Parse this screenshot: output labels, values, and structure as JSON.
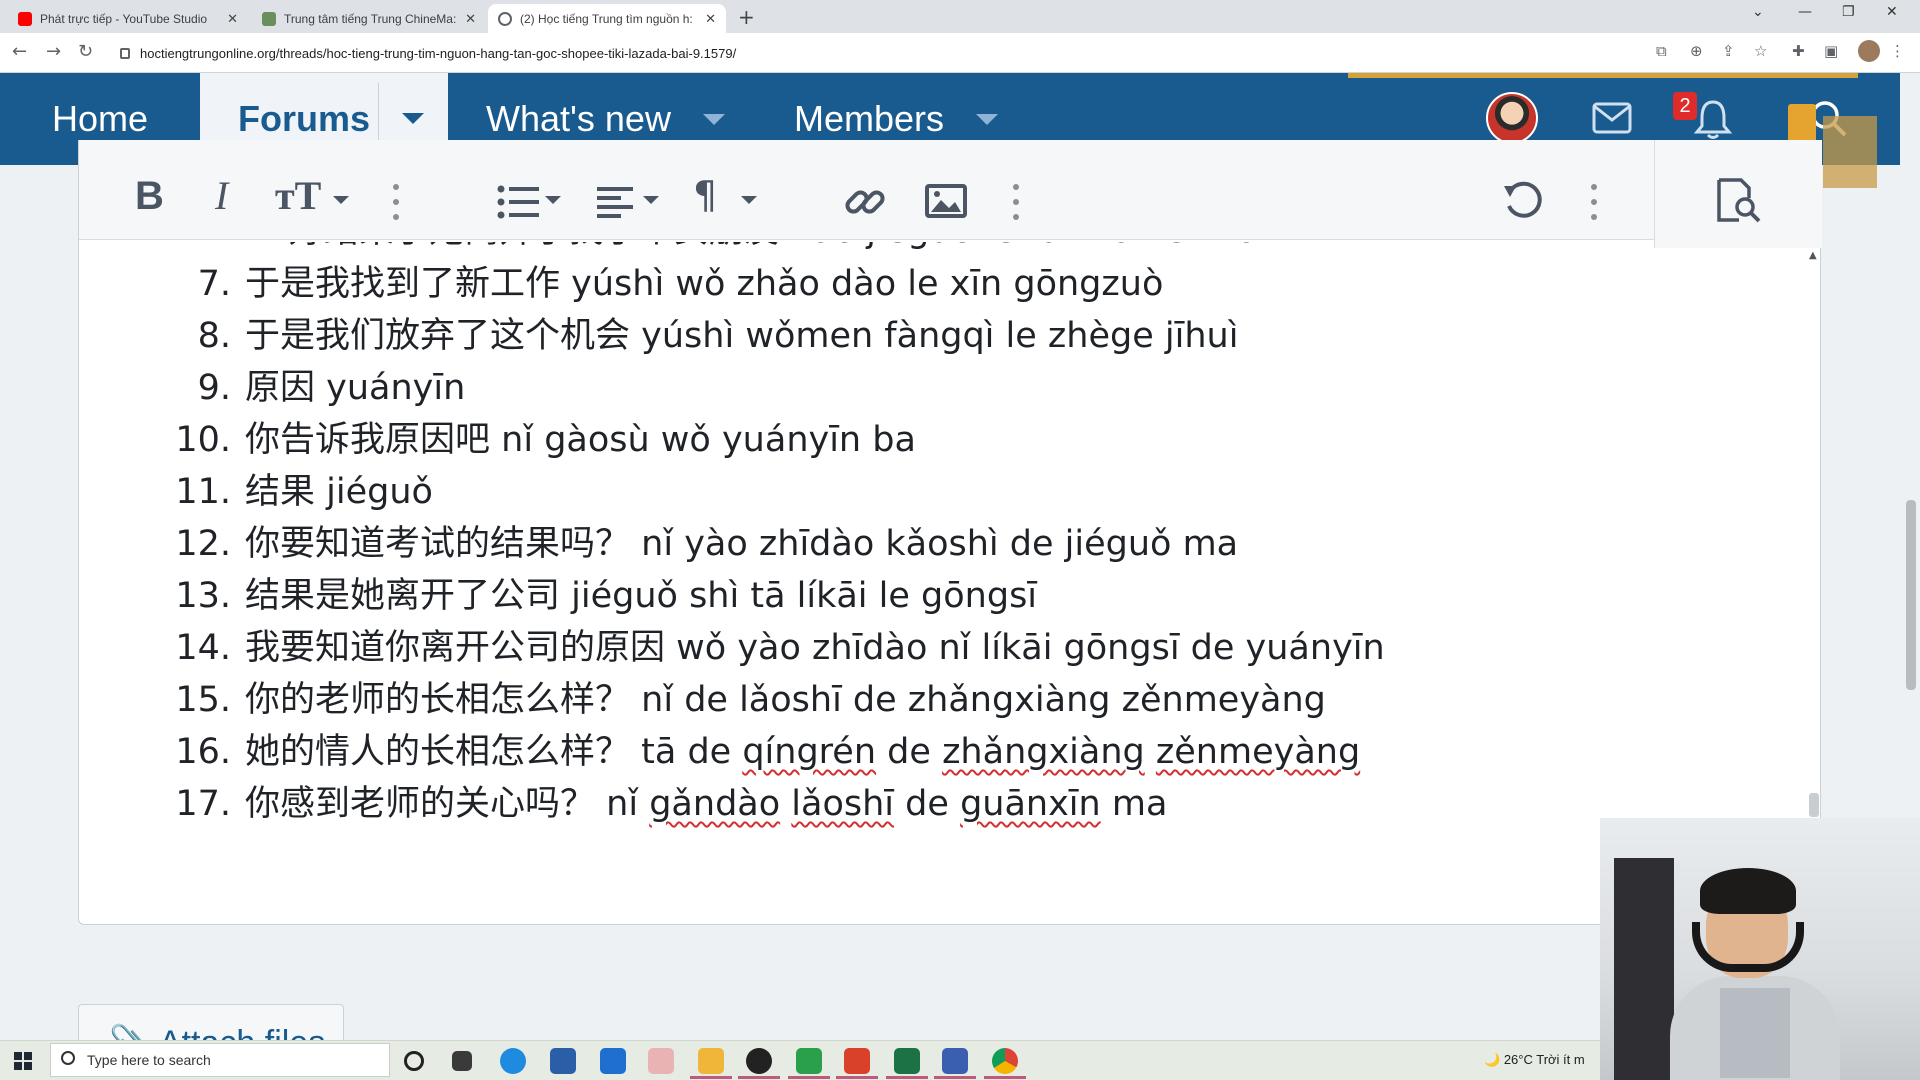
{
  "browser": {
    "tabs": [
      {
        "label": "Phát trực tiếp - YouTube Studio",
        "favicon_color": "#ff0000",
        "active": false
      },
      {
        "label": "Trung tâm tiếng Trung ChineMa:",
        "favicon_color": "#6a8f5a",
        "active": false
      },
      {
        "label": "(2) Học tiếng Trung tìm nguồn h:",
        "favicon_color": "#5f6368",
        "active": true
      }
    ],
    "url": "hoctiengtrungonline.org/threads/hoc-tieng-trung-tim-nguon-hang-tan-goc-shopee-tiki-lazada-bai-9.1579/"
  },
  "forum_nav": {
    "items": [
      {
        "label": "Home"
      },
      {
        "label": "Forums"
      },
      {
        "label": "What's new"
      },
      {
        "label": "Members"
      }
    ],
    "notification_count": "2",
    "colors": {
      "nav_bg": "#1a5b8f",
      "active_bg": "#f0f4f8"
    }
  },
  "editor": {
    "toolbar_icons": [
      "bold-icon",
      "italic-icon",
      "text-size-icon",
      "more-icon",
      "list-icon",
      "align-icon",
      "paragraph-icon",
      "link-icon",
      "image-icon",
      "more-icon",
      "undo-icon",
      "more-icon",
      "preview-icon"
    ],
    "toolbar": {
      "bold": "B",
      "italic": "I",
      "textsize": "тT"
    },
    "lines": [
      {
        "num": "7.",
        "hanzi": "于是我找到了新工作",
        "pinyin": "yúshì wǒ zhǎo dào le xīn gōngzuò"
      },
      {
        "num": "8.",
        "hanzi": "于是我们放弃了这个机会",
        "pinyin": "yúshì wǒmen fàngqì le zhège jīhuì"
      },
      {
        "num": "9.",
        "hanzi": "原因",
        "pinyin": "yuányīn"
      },
      {
        "num": "10.",
        "hanzi": "你告诉我原因吧",
        "pinyin": "nǐ gàosù wǒ yuányīn ba"
      },
      {
        "num": "11.",
        "hanzi": "结果",
        "pinyin": "jiéguǒ"
      },
      {
        "num": "12.",
        "hanzi": "你要知道考试的结果吗？",
        "pinyin": "nǐ yào zhīdào kǎoshì de jiéguǒ ma"
      },
      {
        "num": "13.",
        "hanzi": "结果是她离开了公司",
        "pinyin": "jiéguǒ shì tā líkāi le gōngsī"
      },
      {
        "num": "14.",
        "hanzi": "我要知道你离开公司的原因",
        "pinyin": "wǒ yào zhīdào nǐ líkāi gōngsī de yuányīn"
      },
      {
        "num": "15.",
        "hanzi": "你的老师的长相怎么样？",
        "pinyin": "nǐ de lǎoshī de zhǎngxiàng zěnmeyàng"
      }
    ],
    "line16": {
      "num": "16.",
      "hanzi": "她的情人的长相怎么样？",
      "p1": "tā de",
      "w1": "qíngrén",
      "p2": "de",
      "w2": "zhǎngxiàng",
      "w3": "zěnmeyàng"
    },
    "line17": {
      "num": "17.",
      "hanzi": "你感到老师的关心吗？",
      "p1": "nǐ",
      "w1": "gǎndào",
      "w2": "lǎoshī",
      "p2": "de",
      "w3": "guānxīn",
      "p3": "ma"
    },
    "attach_label": "Attach files"
  },
  "taskbar": {
    "search_placeholder": "Type here to search",
    "weather": "26°C  Trời ít m"
  }
}
